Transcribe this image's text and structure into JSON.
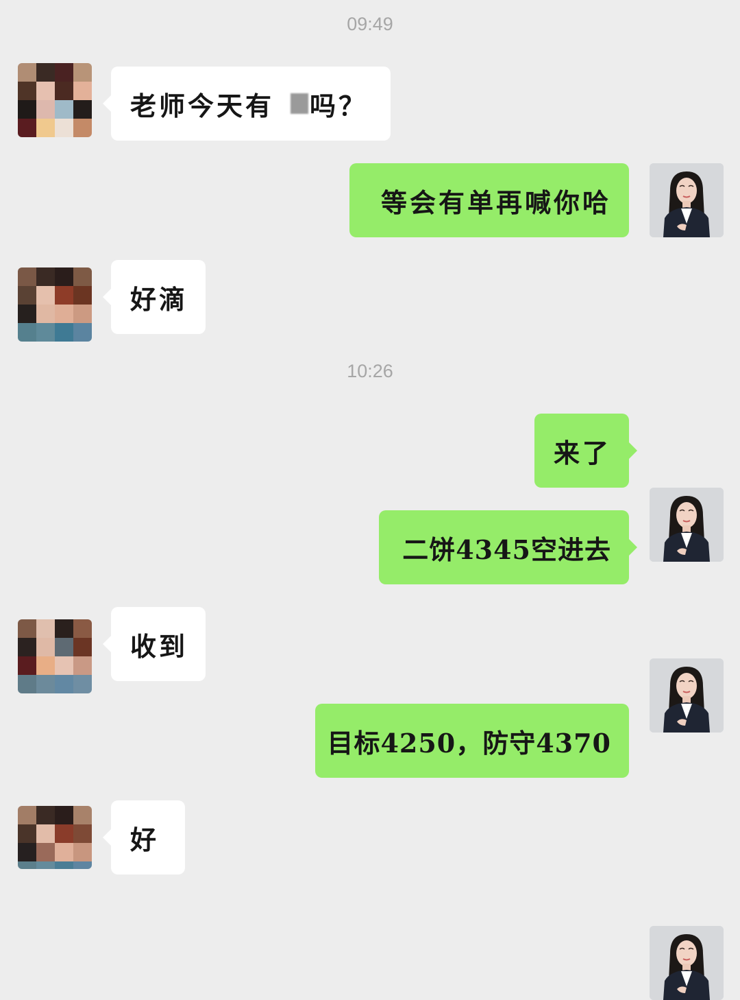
{
  "timestamps": [
    "09:49",
    "10:26"
  ],
  "messages": [
    {
      "side": "in",
      "text_before": "老师今天有",
      "text_after": "吗？",
      "redacted": true
    },
    {
      "side": "out",
      "text": "等会有单再喊你哈"
    },
    {
      "side": "in",
      "text": "好滴"
    },
    {
      "side": "out",
      "text": "来了"
    },
    {
      "side": "out",
      "text": "二饼4345空进去"
    },
    {
      "side": "in",
      "text": "收到"
    },
    {
      "side": "out",
      "text": "目标4250，防守4370"
    },
    {
      "side": "in",
      "text": "好"
    }
  ],
  "avatars": {
    "contact": "pixelated-avatar",
    "self": "woman-in-suit-photo"
  },
  "colors": {
    "background": "#ededed",
    "outgoing_bubble": "#95ec69",
    "incoming_bubble": "#ffffff",
    "timestamp_text": "#a6a6a6"
  }
}
